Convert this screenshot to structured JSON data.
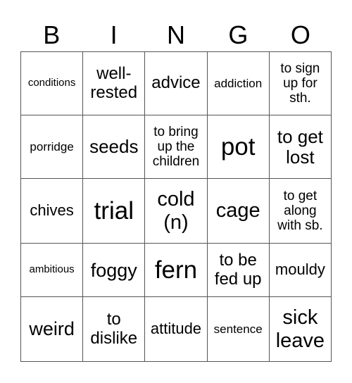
{
  "header": [
    "B",
    "I",
    "N",
    "G",
    "O"
  ],
  "rows": [
    [
      "conditions",
      "well-\nrested",
      "advice",
      "addiction",
      "to sign\nup for\nsth."
    ],
    [
      "porridge",
      "seeds",
      "to bring\nup the\nchildren",
      "pot",
      "to get\nlost"
    ],
    [
      "chives",
      "trial",
      "cold\n(n)",
      "cage",
      "to get\nalong\nwith sb."
    ],
    [
      "ambitious",
      "foggy",
      "fern",
      "to be\nfed up",
      "mouldy"
    ],
    [
      "weird",
      "to\ndislike",
      "attitude",
      "sentence",
      "sick\nleave"
    ]
  ]
}
